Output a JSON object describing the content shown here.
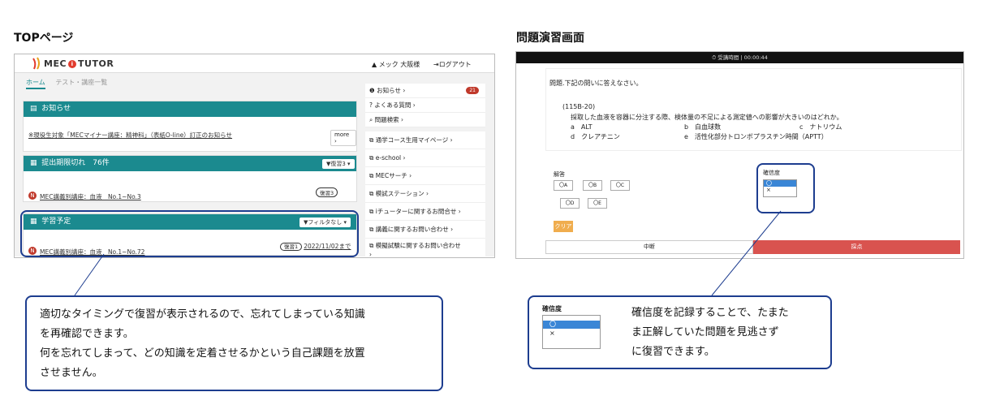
{
  "headings": {
    "top_page": "TOPページ",
    "exercise_page": "問題演習画面"
  },
  "top": {
    "logo_left": "MEC",
    "logo_mark": "i",
    "logo_right": "TUTOR",
    "user": "メック 大阪様",
    "logout": "ログアウト",
    "tabs": [
      "ホーム",
      "テスト・講座一覧"
    ],
    "notice": {
      "title": "お知らせ",
      "link": "※現役生対象「MECマイナー講座：精神科」（表紙O-line）訂正のお知らせ",
      "more": "more ›"
    },
    "deadline": {
      "title": "提出期限切れ　76件",
      "filter": "▼復習3 ▾",
      "item": "MEC講義別講座：血液　No.1~No.3",
      "badge": "復習3"
    },
    "plan": {
      "title": "学習予定",
      "filter": "▼フィルタなし ▾",
      "item": "MEC講義別講座：血液　No.1~No.72",
      "badge": "復習1",
      "date": "2022/11/02まで"
    },
    "side": [
      {
        "label": "お知らせ ›",
        "count": "21"
      },
      {
        "label": "よくある質問 ›"
      },
      {
        "label": "問題検索 ›"
      },
      {
        "label": "通学コース生用マイページ ›"
      },
      {
        "label": "e-school ›"
      },
      {
        "label": "MECサーチ ›"
      },
      {
        "label": "模試ステーション ›"
      },
      {
        "label": "iチューターに関するお問合せ ›"
      },
      {
        "label": "講義に関するお問い合わせ ›"
      },
      {
        "label": "模擬試験に関するお問い合わせ"
      },
      {
        "label": "›"
      }
    ]
  },
  "exercise": {
    "timer": "⏱ 受講時間 | 00:00:44",
    "instruction": "問題.下記の問いに答えなさい。",
    "qid": "(115B-20)",
    "question": "採取した血液を容器に分注する際、検体量の不足による測定値への影響が大きいのはどれか。",
    "choices_text": [
      "a　ALT",
      "b　白血球数",
      "c　ナトリウム",
      "d　クレアチニン",
      "e　活性化部分トロンボプラスチン時間（APTT）"
    ],
    "answer_label": "解答",
    "answer_buttons": [
      "〇A",
      "〇B",
      "〇C",
      "〇D",
      "〇E"
    ],
    "confidence_label": "確信度",
    "confidence_options": [
      "〇",
      "×"
    ],
    "clear": "クリア",
    "interrupt": "中断",
    "grade": "採点"
  },
  "callouts": {
    "left_lines": [
      "適切なタイミングで復習が表示されるので、忘れてしまっている知識",
      "を再確認できます。",
      "何を忘れてしまって、どの知識を定着させるかという自己課題を放置",
      "させません。"
    ],
    "right_label": "確信度",
    "right_options": [
      "〇",
      "×"
    ],
    "right_lines": [
      "確信度を記録することで、たまた",
      "ま正解していた問題を見逃さず",
      "に復習できます。"
    ]
  },
  "colors": {
    "teal": "#1b8a8f",
    "callout_border": "#1d3d8f",
    "red": "#d9534f",
    "orange": "#f0ad4e",
    "blue": "#3a86d6"
  }
}
